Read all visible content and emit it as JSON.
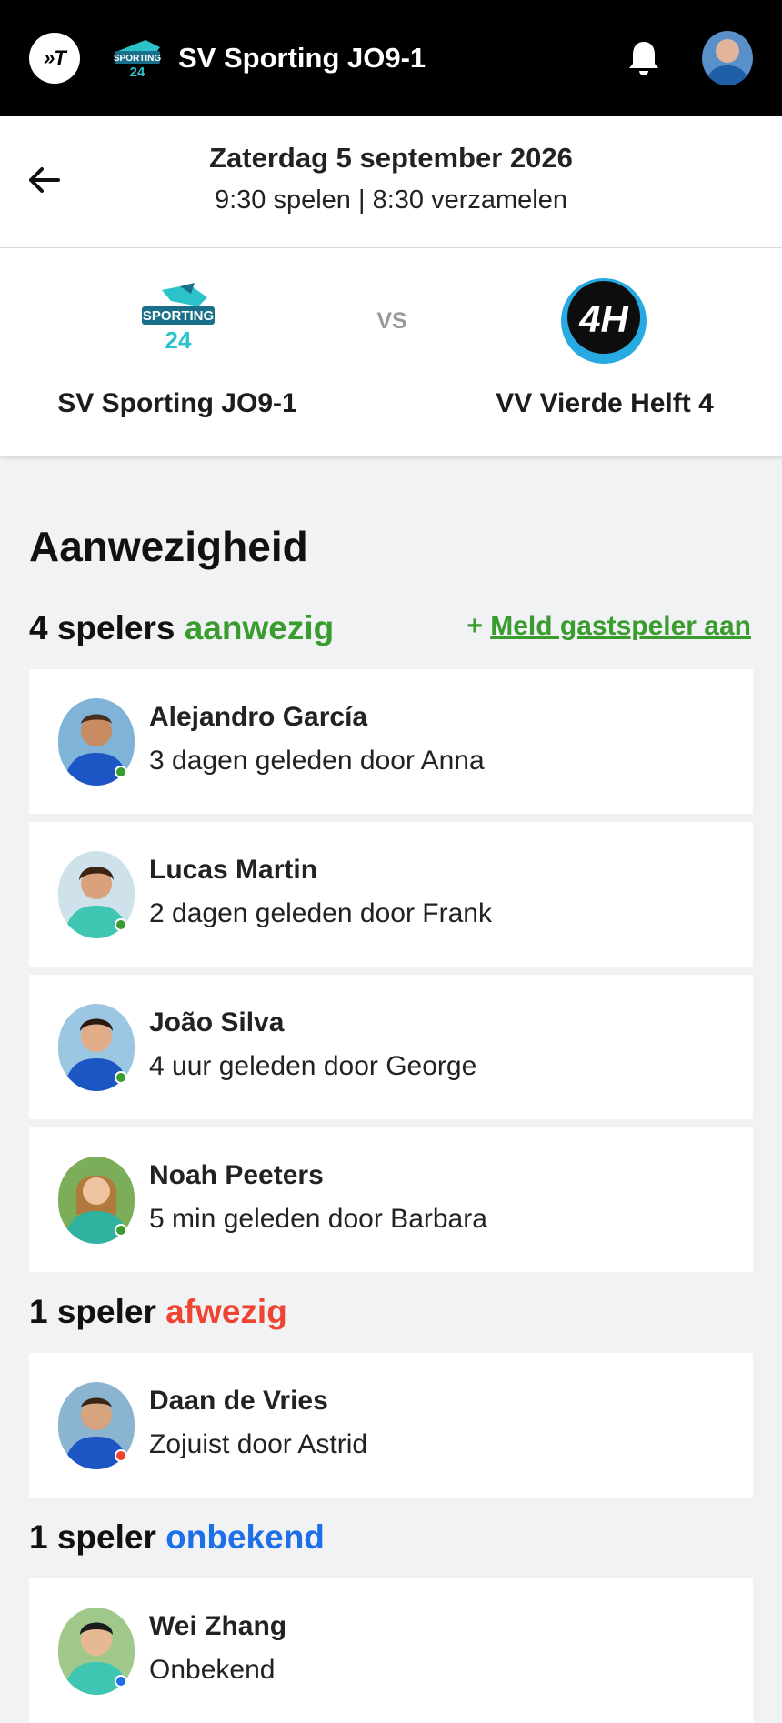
{
  "header": {
    "app_logo_text": "»T",
    "team_title": "SV Sporting JO9-1"
  },
  "match": {
    "date": "Zaterdag 5 september 2026",
    "time": "9:30 spelen | 8:30 verzamelen",
    "vs": "VS",
    "home_team": "SV Sporting JO9-1",
    "away_team": "VV Vierde Helft 4",
    "away_logo_text": "4H"
  },
  "attendance": {
    "title": "Aanwezigheid",
    "guest_link": "Meld gastspeler aan",
    "guest_prefix": "+",
    "present": {
      "count_label": "4 spelers",
      "status_label": "aanwezig",
      "players": [
        {
          "name": "Alejandro García",
          "meta": "3 dagen geleden door Anna"
        },
        {
          "name": "Lucas Martin",
          "meta": "2 dagen geleden door Frank"
        },
        {
          "name": "João Silva",
          "meta": "4 uur geleden door George"
        },
        {
          "name": "Noah Peeters",
          "meta": "5 min geleden door Barbara"
        }
      ]
    },
    "absent": {
      "count_label": "1 speler",
      "status_label": "afwezig",
      "players": [
        {
          "name": "Daan de Vries",
          "meta": "Zojuist door Astrid"
        }
      ]
    },
    "unknown": {
      "count_label": "1 speler",
      "status_label": "onbekend",
      "players": [
        {
          "name": "Wei Zhang",
          "meta": "Onbekend"
        }
      ]
    }
  },
  "colors": {
    "present": "#3a9b2f",
    "absent": "#f04432",
    "unknown": "#1d6fe8",
    "away_logo": "#27a9e1"
  }
}
